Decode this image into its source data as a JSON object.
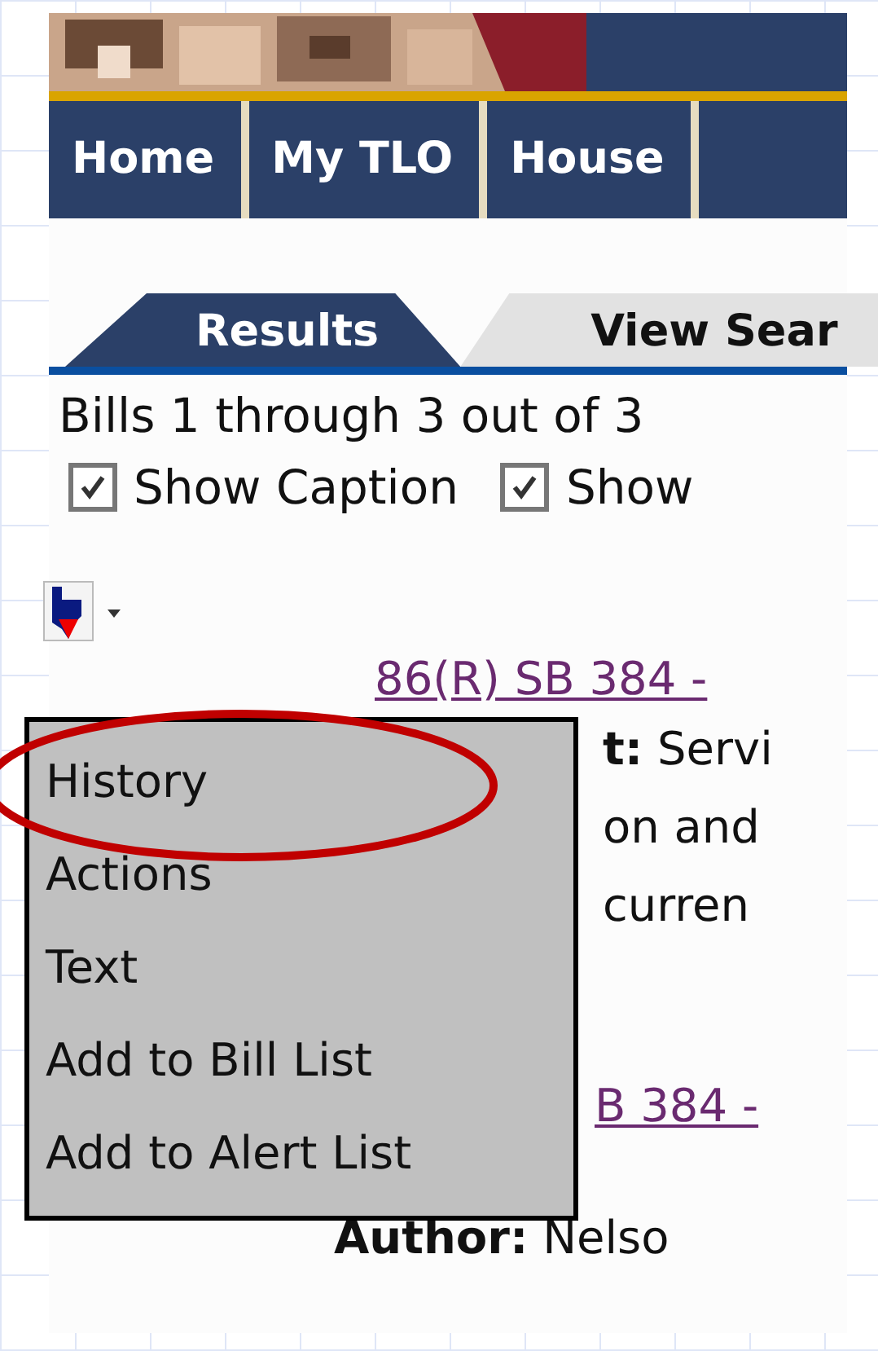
{
  "nav": [
    "Home",
    "My TLO",
    "House"
  ],
  "tabs": [
    {
      "label": "Results",
      "selected": true
    },
    {
      "label": "View Sear",
      "selected": false
    }
  ],
  "summary": "Bills 1 through 3 out of 3",
  "options": [
    {
      "label": "Show Caption",
      "checked": true
    },
    {
      "label": "Show",
      "checked": true
    }
  ],
  "bills": [
    {
      "link": "86(R) SB 384 -",
      "lines": [
        "**t:** Servi",
        "on and",
        "curren"
      ]
    },
    {
      "link": "B 384 -",
      "lines": [
        "**Author:** Nelso"
      ]
    }
  ],
  "menu": {
    "items": [
      "History",
      "Actions",
      "Text",
      "Add to Bill List",
      "Add to Alert List"
    ]
  }
}
